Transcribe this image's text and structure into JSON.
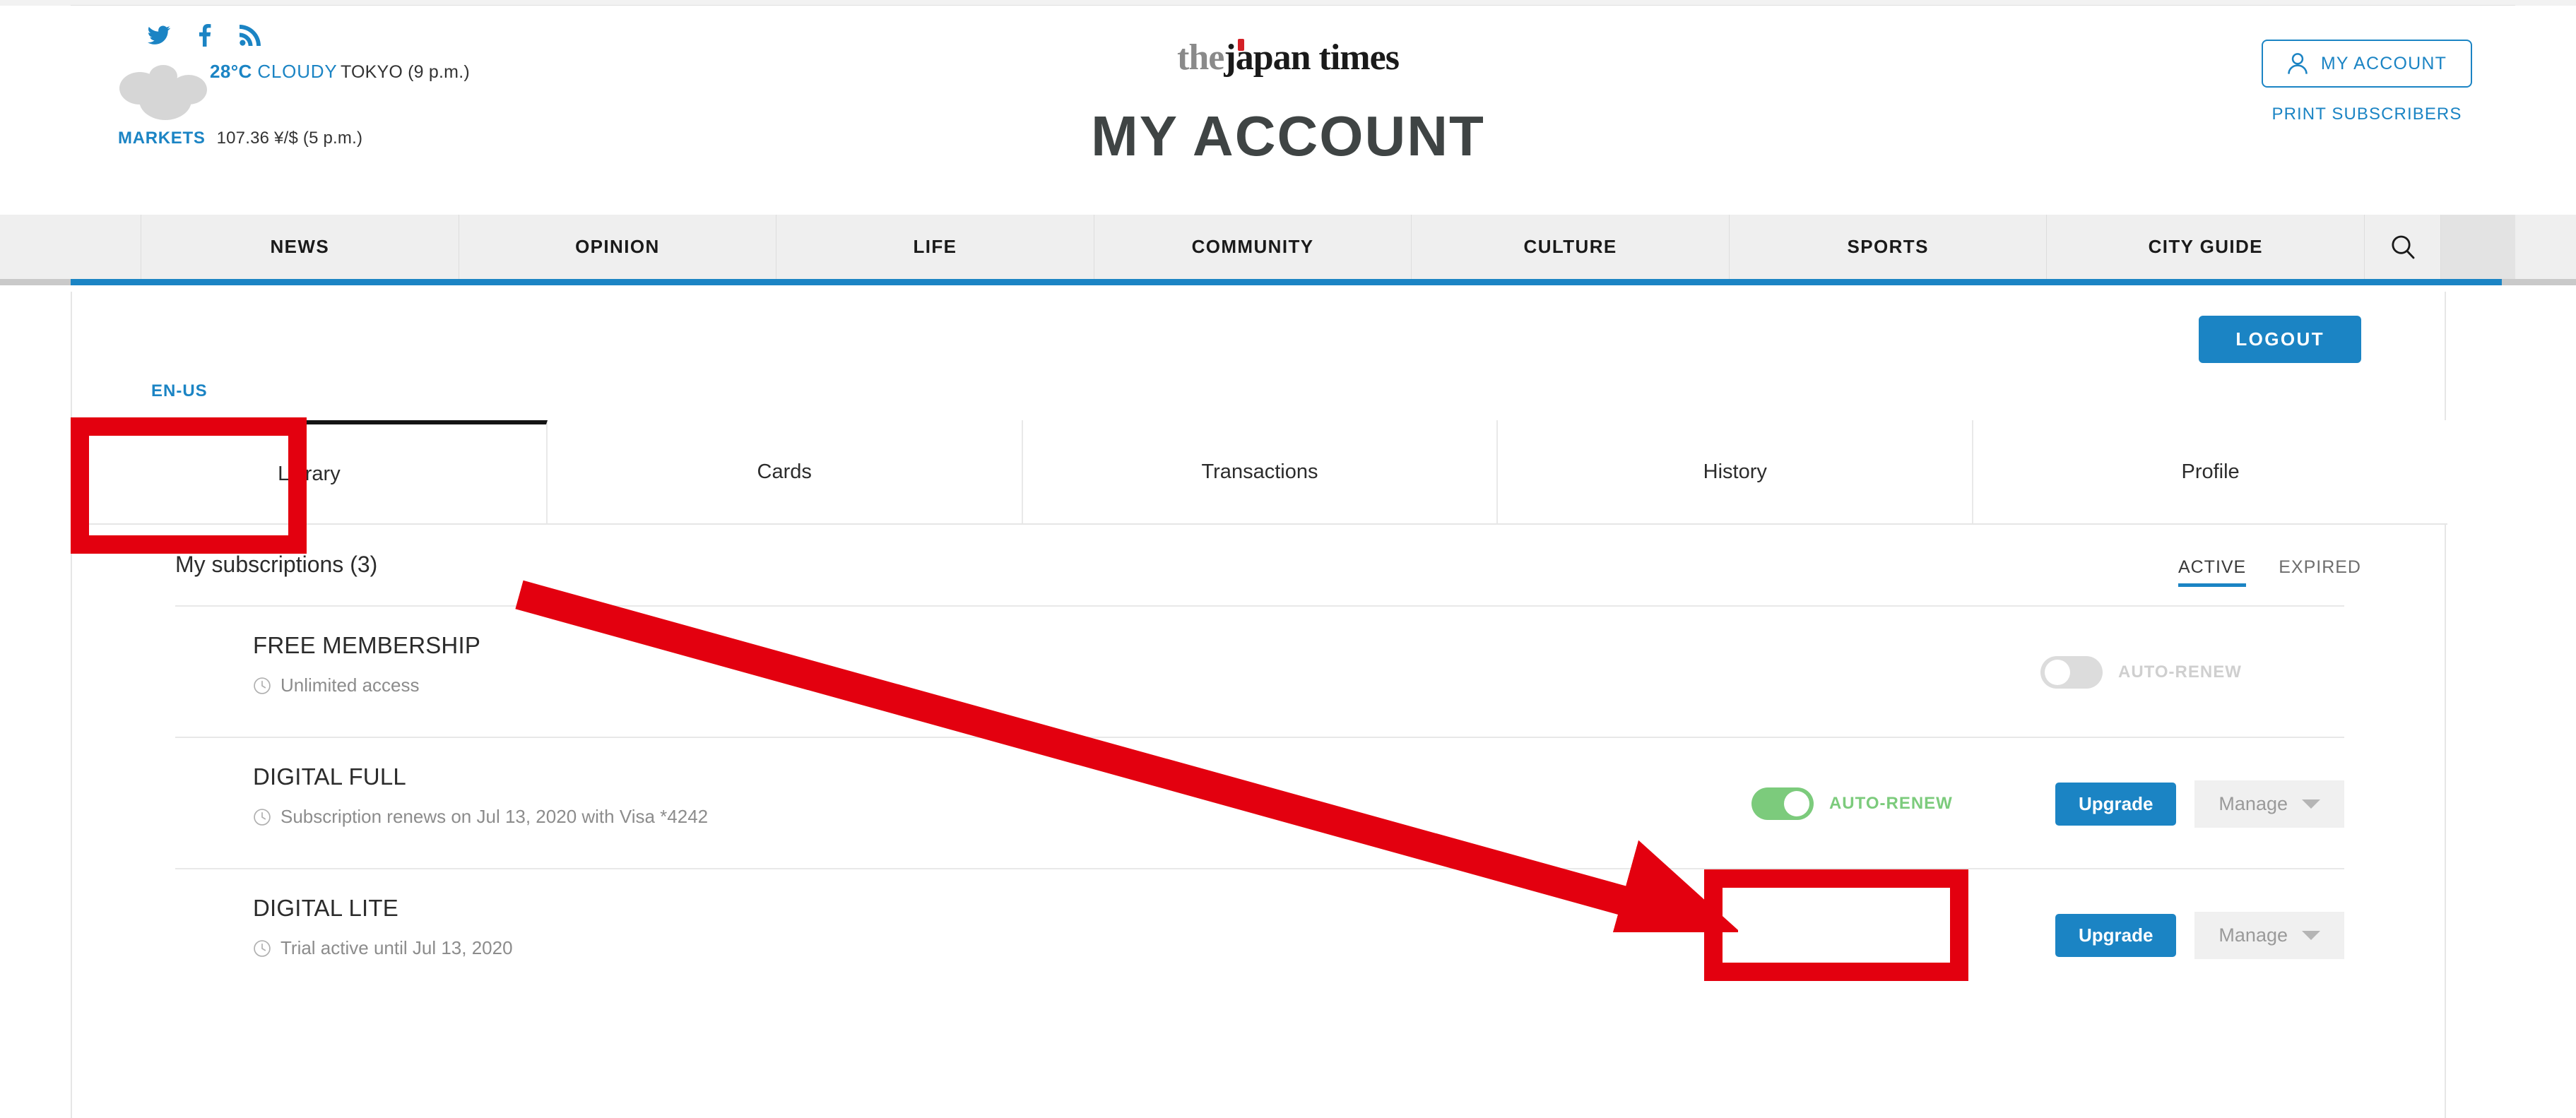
{
  "header": {
    "social": [
      {
        "name": "twitter-icon",
        "label": "Twitter"
      },
      {
        "name": "facebook-icon",
        "label": "Facebook"
      },
      {
        "name": "rss-icon",
        "label": "RSS"
      }
    ],
    "weather": {
      "temperature": "28°C",
      "condition": "CLOUDY",
      "location_time": "TOKYO (9 p.m.)",
      "icon": "cloudy-icon"
    },
    "markets": {
      "label": "MARKETS",
      "value": "107.36 ¥/$ (5 p.m.)"
    },
    "logo": {
      "the": "the",
      "name": "japan times"
    },
    "page_title": "MY ACCOUNT",
    "my_account_button": "MY ACCOUNT",
    "print_subscribers": "PRINT SUBSCRIBERS"
  },
  "nav": {
    "items": [
      "NEWS",
      "OPINION",
      "LIFE",
      "COMMUNITY",
      "CULTURE",
      "SPORTS",
      "CITY GUIDE"
    ],
    "search_icon": "search-icon",
    "accent_color": "#1b84c4"
  },
  "panel": {
    "logout_label": "LOGOUT",
    "language": "EN-US"
  },
  "tabs": [
    {
      "label": "Library",
      "active": true
    },
    {
      "label": "Cards",
      "active": false
    },
    {
      "label": "Transactions",
      "active": false
    },
    {
      "label": "History",
      "active": false
    },
    {
      "label": "Profile",
      "active": false
    }
  ],
  "subscriptions": {
    "title": "My subscriptions (3)",
    "filters": [
      {
        "label": "ACTIVE",
        "selected": true
      },
      {
        "label": "EXPIRED",
        "selected": false
      }
    ],
    "rows": [
      {
        "name": "FREE MEMBERSHIP",
        "detail": "Unlimited access",
        "detail_icon": "clock-icon",
        "auto_renew": {
          "label": "AUTO-RENEW",
          "state": "off"
        },
        "upgrade_label": null,
        "manage_label": null
      },
      {
        "name": "DIGITAL FULL",
        "detail": "Subscription renews on Jul 13, 2020 with Visa *4242",
        "detail_icon": "clock-icon",
        "auto_renew": {
          "label": "AUTO-RENEW",
          "state": "on"
        },
        "upgrade_label": "Upgrade",
        "manage_label": "Manage"
      },
      {
        "name": "DIGITAL LITE",
        "detail": "Trial active until Jul 13, 2020",
        "detail_icon": "clock-icon",
        "auto_renew": null,
        "upgrade_label": "Upgrade",
        "manage_label": "Manage"
      }
    ]
  },
  "annotations": {
    "color": "#e3000f",
    "highlight_tab": "Library",
    "highlight_control": "AUTO-RENEW toggle",
    "arrow": "points from Library tab to DIGITAL FULL auto-renew toggle"
  },
  "colors": {
    "brand_blue": "#1b84c4",
    "toggle_on_green": "#7ccb7c",
    "annotation_red": "#e3000f",
    "nav_bg": "#efefef"
  }
}
